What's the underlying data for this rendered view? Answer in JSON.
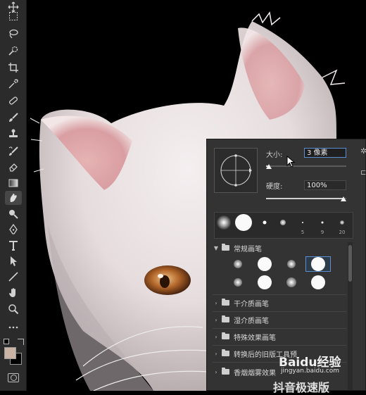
{
  "toolbar": {
    "tools": [
      {
        "name": "move-tool",
        "glyph": "move"
      },
      {
        "name": "marquee-tool",
        "glyph": "marquee"
      },
      {
        "name": "lasso-tool",
        "glyph": "lasso"
      },
      {
        "name": "quick-select-tool",
        "glyph": "quick"
      },
      {
        "name": "crop-tool",
        "glyph": "crop"
      },
      {
        "name": "eyedropper-tool",
        "glyph": "eyedropper"
      },
      {
        "name": "healing-tool",
        "glyph": "heal"
      },
      {
        "name": "brush-tool",
        "glyph": "brush"
      },
      {
        "name": "stamp-tool",
        "glyph": "stamp"
      },
      {
        "name": "history-brush-tool",
        "glyph": "history"
      },
      {
        "name": "eraser-tool",
        "glyph": "eraser"
      },
      {
        "name": "gradient-tool",
        "glyph": "gradient"
      },
      {
        "name": "smudge-tool",
        "glyph": "smudge"
      },
      {
        "name": "dodge-tool",
        "glyph": "dodge"
      },
      {
        "name": "pen-tool",
        "glyph": "pen"
      },
      {
        "name": "type-tool",
        "glyph": "T"
      },
      {
        "name": "path-select-tool",
        "glyph": "arrow"
      },
      {
        "name": "line-tool",
        "glyph": "line"
      },
      {
        "name": "hand-tool",
        "glyph": "hand"
      },
      {
        "name": "zoom-tool",
        "glyph": "zoom"
      },
      {
        "name": "more-tools",
        "glyph": "..."
      }
    ],
    "active_tool": "smudge-tool",
    "foreground_color": "#c9b3a4",
    "background_color": "#000000"
  },
  "brush_panel": {
    "size_label": "大小:",
    "size_value": "3 像素",
    "size_fraction": 0.0,
    "hardness_label": "硬度:",
    "hardness_value": "100%",
    "hardness_fraction": 1.0,
    "recent_brush_sizes": [
      "",
      "",
      "",
      "",
      "5",
      "9",
      "20"
    ],
    "groups": [
      {
        "label": "常规画笔",
        "expanded": true
      },
      {
        "label": "干介质画笔",
        "expanded": false
      },
      {
        "label": "湿介质画笔",
        "expanded": false
      },
      {
        "label": "特殊效果画笔",
        "expanded": false
      },
      {
        "label": "转换后的旧版工具预",
        "expanded": false
      },
      {
        "label": "香烟烟雾效果",
        "expanded": false
      }
    ]
  },
  "watermark": {
    "baidu_text": "Baidu经验",
    "baidu_url": "jingyan.baidu.com",
    "bottom_text": "抖音极速版"
  }
}
